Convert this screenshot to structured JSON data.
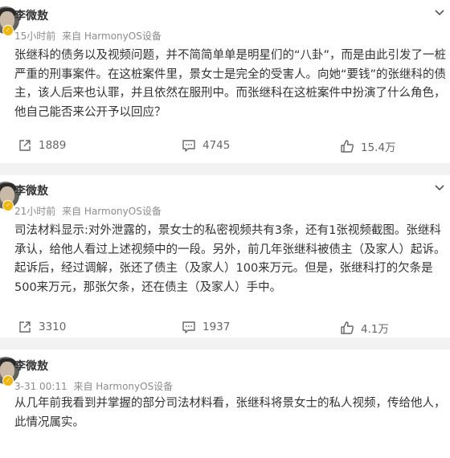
{
  "posts": [
    {
      "author": "李微敖",
      "time": "15小时前",
      "source": "来自 HarmonyOS设备",
      "text": "张继科的债务以及视频问题，并不简简单单是明星们的“八卦”，而是由此引发了一桩严重的刑事案件。在这桩案件里，景女士是完全的受害人。向她“要钱”的张继科的债主，该人后来也认罪，并且依然在服刑中。而张继科在这桩案件中扮演了什么角色，他自己能否来公开予以回应？",
      "shares": "1889",
      "comments": "4745",
      "likes": "15.4万"
    },
    {
      "author": "李微敖",
      "time": "21小时前",
      "source": "来自 HarmonyOS设备",
      "text": "司法材料显示:对外泄露的，景女士的私密视频共有3条，还有1张视频截图。张继科承认，给他人看过上述视频中的一段。另外，前几年张继科被债主（及家人）起诉。起诉后，经过调解，张还了债主（及家人）100来万元。但是，张继科打的欠条是500来万元，那张欠条，还在债主（及家人）手中。",
      "shares": "3310",
      "comments": "1937",
      "likes": "4.1万"
    },
    {
      "author": "李微敖",
      "time": "3-31 00:11",
      "source": "来自 HarmonyOS设备",
      "text": "从几年前我看到并掌握的部分司法材料看，张继科将景女士的私人视频，传给他人，此情况属实。"
    }
  ],
  "icons": {
    "share": "share-icon",
    "comment": "comment-icon",
    "like": "like-icon",
    "more": "chevron-down-icon",
    "verified": "verified-badge-icon"
  },
  "colors": {
    "text": "#333333",
    "meta": "#8c8c8c",
    "action": "#666666",
    "separator": "#f2f2f2",
    "badge": "#f7b500"
  }
}
